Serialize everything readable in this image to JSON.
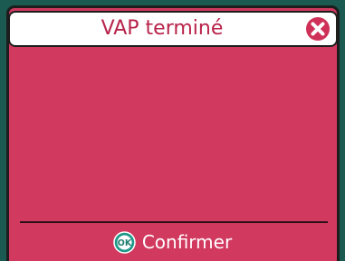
{
  "dialog": {
    "title": "VAP terminé",
    "close_icon": "close-icon",
    "confirm_icon": "ok-icon",
    "confirm_icon_text": "OK",
    "confirm_label": "Confirmer"
  },
  "colors": {
    "background": "#1a5a50",
    "dialog_body": "#d1395f",
    "title_text": "#b8234a",
    "close_icon": "#cf3057",
    "ok_icon": "#1f9a8a"
  }
}
